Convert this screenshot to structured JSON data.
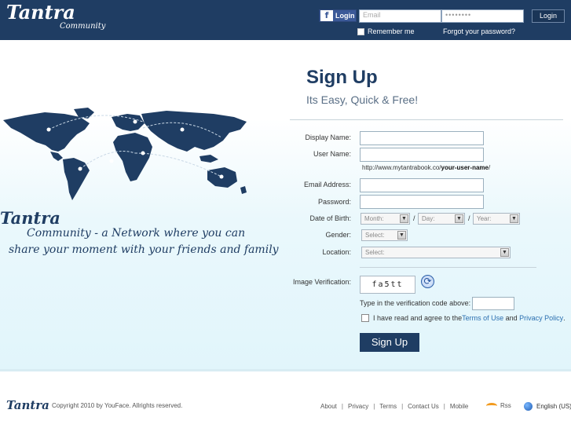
{
  "header": {
    "logo_big": "Tantra",
    "logo_small": "Community",
    "fb_login_label": "Login",
    "fb_letter": "f",
    "email_placeholder": "Email",
    "password_placeholder": "••••••••",
    "login_button": "Login",
    "remember_me": "Remember me",
    "forgot_password": "Forgot your password?"
  },
  "hero": {
    "tagline_big": "Tantra",
    "tagline_line1": "Community - a Network where you can",
    "tagline_line2": "share your moment with your friends and family"
  },
  "signup": {
    "title": "Sign Up",
    "subtitle": "Its Easy, Quick & Free!",
    "display_name_label": "Display Name:",
    "user_name_label": "User Name:",
    "url_prefix": "http://www.mytantrabook.co/",
    "url_bold": "your-user-name",
    "url_suffix": "/",
    "email_label": "Email Address:",
    "password_label": "Password:",
    "dob_label": "Date of Birth:",
    "month": "Month:",
    "day": "Day:",
    "year": "Year:",
    "slash": "/",
    "gender_label": "Gender:",
    "gender_select": "Select:",
    "location_label": "Location:",
    "location_select": "Select:",
    "image_verification_label": "Image Verification:",
    "captcha_text": "fa5tt",
    "code_label": "Type in the verification code above:",
    "agree_prefix": "I have read and agree to the ",
    "terms": "Terms of Use",
    "and": " and ",
    "privacy": "Privacy Policy",
    "period": ".",
    "button": "Sign Up"
  },
  "footer": {
    "logo": "Tantra",
    "copyright": "Copyright 2010 by YouFace. Allrights reserved.",
    "links": [
      "About",
      "Privacy",
      "Terms",
      "Contact Us",
      "Mobile"
    ],
    "rss": "Rss",
    "language": "English (US)"
  },
  "colors": {
    "brand_navy": "#1f3d63",
    "link_blue": "#2a6fb0",
    "facebook": "#3b5998",
    "rss_orange": "#f29a1e"
  }
}
